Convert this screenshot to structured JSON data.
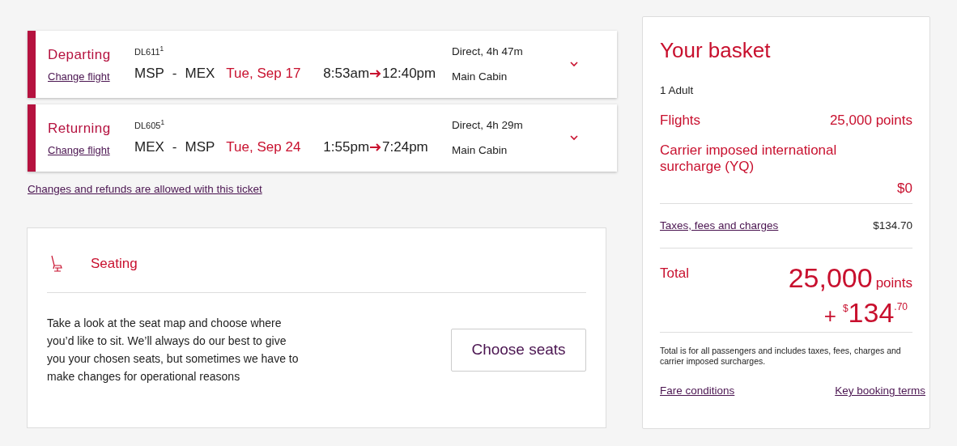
{
  "flights": [
    {
      "direction": "Departing",
      "change_link": "Change flight",
      "flight_number": "DL611$^{1}$",
      "origin": "MSP",
      "separator": "-",
      "destination": "MEX",
      "date": "Tue, Sep 17",
      "depart_time": "8:53am",
      "arrive_time": "12:40pm",
      "duration": "Direct, 4h 47m",
      "cabin": "Main Cabin"
    },
    {
      "direction": "Returning",
      "change_link": "Change flight",
      "flight_number": "DL605$^{1}$",
      "origin": "MEX",
      "separator": "-",
      "destination": "MSP",
      "date": "Tue, Sep 24",
      "depart_time": "1:55pm",
      "arrive_time": "7:24pm",
      "duration": "Direct, 4h 29m",
      "cabin": "Main Cabin"
    }
  ],
  "ticket_link": "Changes and refunds are allowed with this ticket",
  "seating": {
    "title": "Seating",
    "description": "Take a look at the seat map and choose where you’d like to sit. We’ll always do our best to give you your chosen seats, but sometimes we have to make changes for operational reasons",
    "button": "Choose seats"
  },
  "basket": {
    "title": "Your basket",
    "passengers": "1 Adult",
    "flights": {
      "label": "Flights",
      "value": "25,000 points"
    },
    "surcharge": {
      "label": "Carrier imposed international surcharge (YQ)",
      "value": "$0"
    },
    "taxes": {
      "label": "Taxes, fees and charges",
      "value": "$134.70"
    },
    "total": {
      "label": "Total",
      "points": "25,000",
      "points_unit": "points",
      "plus": "+",
      "currency": "$",
      "amount": "134",
      "cents": ".70"
    },
    "note": "Total is for all passengers and includes taxes, fees, charges and carrier imposed surcharges.",
    "links": [
      "Fare conditions",
      "Key booking terms"
    ]
  }
}
